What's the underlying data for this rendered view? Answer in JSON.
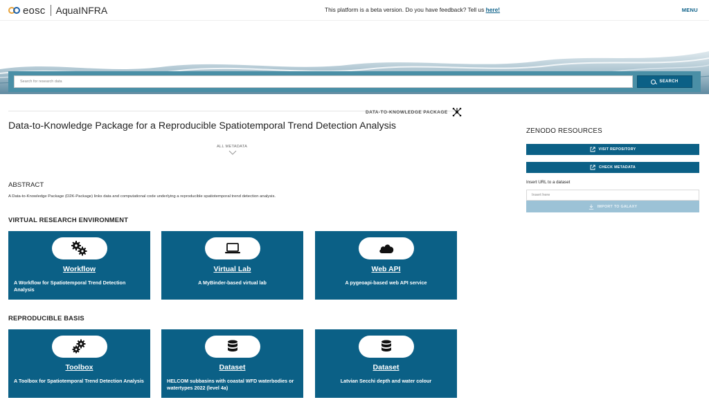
{
  "header": {
    "logo_brand": "eosc",
    "app_name": "AquaINFRA",
    "beta_text": "This platform is a beta version. Do you have feedback? Tell us ",
    "beta_link": "here!",
    "menu_label": "MENU"
  },
  "search": {
    "placeholder": "Search for research data",
    "button_label": "SEARCH"
  },
  "package": {
    "type_label": "DATA-TO-KNOWLEDGE PACKAGE",
    "title": "Data-to-Knowledge Package for a Reproducible Spatiotemporal Trend Detection Analysis",
    "all_metadata_label": "ALL METADATA"
  },
  "abstract": {
    "heading": "ABSTRACT",
    "text": "A Data-to-Knowledge Package (D2K-Package) links data and computational code underlying a reproducible spatiotemporal trend detection analysis."
  },
  "vre": {
    "heading": "VIRTUAL RESEARCH ENVIRONMENT",
    "cards": [
      {
        "title": "Workflow",
        "desc": "A Workflow for Spatiotemporal Trend Detection Analysis",
        "icon": "gears-icon"
      },
      {
        "title": "Virtual Lab",
        "desc": "A MyBinder-based virtual lab",
        "icon": "laptop-icon"
      },
      {
        "title": "Web API",
        "desc": "A pygeoapi-based web API service",
        "icon": "cloud-icon"
      }
    ]
  },
  "basis": {
    "heading": "REPRODUCIBLE BASIS",
    "cards": [
      {
        "title": "Toolbox",
        "desc": "A Toolbox for Spatiotemporal Trend Detection Analysis",
        "icon": "gears-icon"
      },
      {
        "title": "Dataset",
        "desc": "HELCOM subbasins with coastal WFD waterbodies or watertypes 2022 (level 4a)",
        "icon": "database-icon"
      },
      {
        "title": "Dataset",
        "desc": "Latvian Secchi depth and water colour",
        "icon": "database-icon"
      }
    ]
  },
  "sidebar": {
    "heading": "ZENODO RESOURCES",
    "visit_label": "VISIT REPOSITORY",
    "check_label": "CHECK METADATA",
    "insert_label": "Insert URL to a dataset",
    "insert_placeholder": "Insert here",
    "import_label": "IMPORT TO GALAXY"
  },
  "colors": {
    "primary": "#0b6086",
    "searchbar": "#4a8fa6",
    "disabled": "#9cc2d6"
  }
}
